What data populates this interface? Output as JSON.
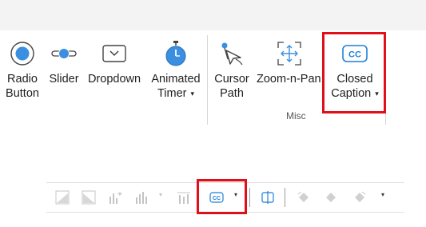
{
  "ribbon": {
    "buttons": {
      "radio": {
        "line1": "Radio",
        "line2": "Button",
        "icon": "radio-button-icon"
      },
      "slider": {
        "label": "Slider",
        "icon": "slider-icon"
      },
      "dropdown": {
        "label": "Dropdown",
        "icon": "dropdown-icon"
      },
      "timer": {
        "line1": "Animated",
        "line2": "Timer",
        "caret": "▾",
        "icon": "stopwatch-icon"
      },
      "cursor": {
        "line1": "Cursor",
        "line2": "Path",
        "icon": "cursor-path-icon"
      },
      "zoom": {
        "label": "Zoom-n-Pan",
        "icon": "zoom-n-pan-icon"
      },
      "closed_caption": {
        "line1": "Closed",
        "line2": "Caption",
        "caret": "▾",
        "icon": "cc-icon",
        "glyph": "CC"
      }
    },
    "groups": {
      "misc": "Misc"
    }
  },
  "toolbar": {
    "cc_glyph": "CC",
    "caret": "▾"
  },
  "colors": {
    "accent_blue": "#1e7fd6",
    "highlight_red": "#e0101b",
    "disabled_gray": "#c4c4c4"
  }
}
